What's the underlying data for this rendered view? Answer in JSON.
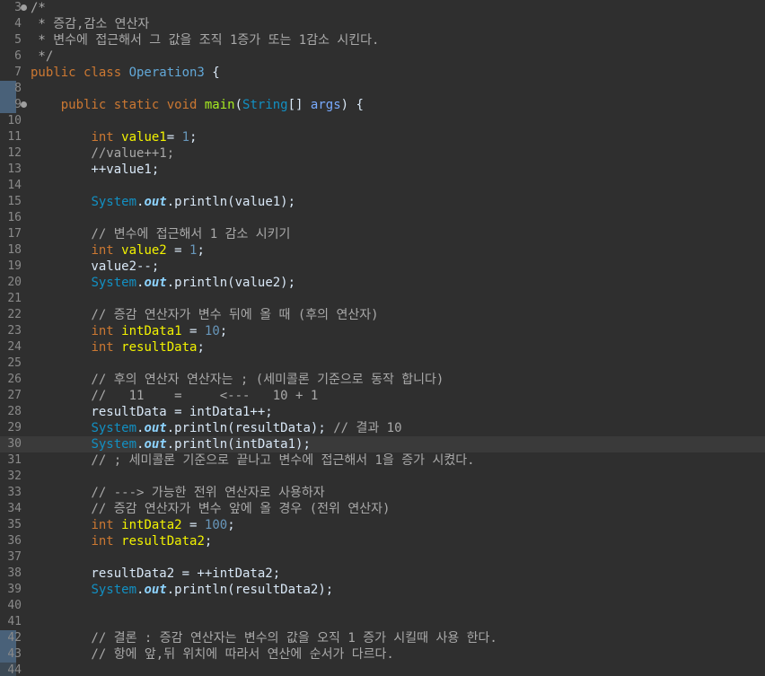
{
  "editor": {
    "lines": [
      {
        "num": "3",
        "fold": true,
        "mark": false,
        "current": false,
        "tokens": [
          {
            "t": "/*",
            "c": "comment"
          }
        ]
      },
      {
        "num": "4",
        "fold": false,
        "mark": false,
        "current": false,
        "tokens": [
          {
            "t": " * 증감,감소 연산자",
            "c": "comment"
          }
        ]
      },
      {
        "num": "5",
        "fold": false,
        "mark": false,
        "current": false,
        "tokens": [
          {
            "t": " * 변수에 접근해서 그 값을 조직 1증가 또는 1감소 시킨다.",
            "c": "comment"
          }
        ]
      },
      {
        "num": "6",
        "fold": false,
        "mark": false,
        "current": false,
        "tokens": [
          {
            "t": " */",
            "c": "comment"
          }
        ]
      },
      {
        "num": "7",
        "fold": false,
        "mark": false,
        "current": false,
        "tokens": [
          {
            "t": "public class ",
            "c": "keyword"
          },
          {
            "t": "Operation3",
            "c": "class"
          },
          {
            "t": " {",
            "c": "text"
          }
        ]
      },
      {
        "num": "8",
        "fold": false,
        "mark": true,
        "current": false,
        "tokens": []
      },
      {
        "num": "9",
        "fold": true,
        "mark": true,
        "current": false,
        "tokens": [
          {
            "t": "    ",
            "c": "text"
          },
          {
            "t": "public static void ",
            "c": "keyword"
          },
          {
            "t": "main",
            "c": "method"
          },
          {
            "t": "(",
            "c": "text"
          },
          {
            "t": "String",
            "c": "type"
          },
          {
            "t": "[] ",
            "c": "text"
          },
          {
            "t": "args",
            "c": "param"
          },
          {
            "t": ") {",
            "c": "text"
          }
        ]
      },
      {
        "num": "10",
        "fold": false,
        "mark": false,
        "current": false,
        "tokens": []
      },
      {
        "num": "11",
        "fold": false,
        "mark": false,
        "current": false,
        "tokens": [
          {
            "t": "        ",
            "c": "text"
          },
          {
            "t": "int ",
            "c": "keyword"
          },
          {
            "t": "value1",
            "c": "local"
          },
          {
            "t": "= ",
            "c": "text"
          },
          {
            "t": "1",
            "c": "number"
          },
          {
            "t": ";",
            "c": "text"
          }
        ]
      },
      {
        "num": "12",
        "fold": false,
        "mark": false,
        "current": false,
        "tokens": [
          {
            "t": "        //value++1;",
            "c": "comment"
          }
        ]
      },
      {
        "num": "13",
        "fold": false,
        "mark": false,
        "current": false,
        "tokens": [
          {
            "t": "        ++value1;",
            "c": "text"
          }
        ]
      },
      {
        "num": "14",
        "fold": false,
        "mark": false,
        "current": false,
        "tokens": []
      },
      {
        "num": "15",
        "fold": false,
        "mark": false,
        "current": false,
        "tokens": [
          {
            "t": "        ",
            "c": "text"
          },
          {
            "t": "System",
            "c": "type"
          },
          {
            "t": ".",
            "c": "text"
          },
          {
            "t": "out",
            "c": "field"
          },
          {
            "t": ".println(value1);",
            "c": "text"
          }
        ]
      },
      {
        "num": "16",
        "fold": false,
        "mark": false,
        "current": false,
        "tokens": []
      },
      {
        "num": "17",
        "fold": false,
        "mark": false,
        "current": false,
        "tokens": [
          {
            "t": "        // 변수에 접근해서 1 감소 시키기",
            "c": "comment"
          }
        ]
      },
      {
        "num": "18",
        "fold": false,
        "mark": false,
        "current": false,
        "tokens": [
          {
            "t": "        ",
            "c": "text"
          },
          {
            "t": "int ",
            "c": "keyword"
          },
          {
            "t": "value2",
            "c": "local"
          },
          {
            "t": " = ",
            "c": "text"
          },
          {
            "t": "1",
            "c": "number"
          },
          {
            "t": ";",
            "c": "text"
          }
        ]
      },
      {
        "num": "19",
        "fold": false,
        "mark": false,
        "current": false,
        "tokens": [
          {
            "t": "        value2--;",
            "c": "text"
          }
        ]
      },
      {
        "num": "20",
        "fold": false,
        "mark": false,
        "current": false,
        "tokens": [
          {
            "t": "        ",
            "c": "text"
          },
          {
            "t": "System",
            "c": "type"
          },
          {
            "t": ".",
            "c": "text"
          },
          {
            "t": "out",
            "c": "field"
          },
          {
            "t": ".println(value2);",
            "c": "text"
          }
        ]
      },
      {
        "num": "21",
        "fold": false,
        "mark": false,
        "current": false,
        "tokens": []
      },
      {
        "num": "22",
        "fold": false,
        "mark": false,
        "current": false,
        "tokens": [
          {
            "t": "        // 증감 연산자가 변수 뒤에 올 때 (후의 연산자)",
            "c": "comment"
          }
        ]
      },
      {
        "num": "23",
        "fold": false,
        "mark": false,
        "current": false,
        "tokens": [
          {
            "t": "        ",
            "c": "text"
          },
          {
            "t": "int ",
            "c": "keyword"
          },
          {
            "t": "intData1",
            "c": "local"
          },
          {
            "t": " = ",
            "c": "text"
          },
          {
            "t": "10",
            "c": "number"
          },
          {
            "t": ";",
            "c": "text"
          }
        ]
      },
      {
        "num": "24",
        "fold": false,
        "mark": false,
        "current": false,
        "tokens": [
          {
            "t": "        ",
            "c": "text"
          },
          {
            "t": "int ",
            "c": "keyword"
          },
          {
            "t": "resultData",
            "c": "local"
          },
          {
            "t": ";",
            "c": "text"
          }
        ]
      },
      {
        "num": "25",
        "fold": false,
        "mark": false,
        "current": false,
        "tokens": []
      },
      {
        "num": "26",
        "fold": false,
        "mark": false,
        "current": false,
        "tokens": [
          {
            "t": "        // 후의 연산자 연산자는 ; (세미콜론 기준으로 동작 합니다)",
            "c": "comment"
          }
        ]
      },
      {
        "num": "27",
        "fold": false,
        "mark": false,
        "current": false,
        "tokens": [
          {
            "t": "        //   11    =     <---   10 + 1",
            "c": "comment"
          }
        ]
      },
      {
        "num": "28",
        "fold": false,
        "mark": false,
        "current": false,
        "tokens": [
          {
            "t": "        resultData = intData1++;",
            "c": "text"
          }
        ]
      },
      {
        "num": "29",
        "fold": false,
        "mark": false,
        "current": false,
        "tokens": [
          {
            "t": "        ",
            "c": "text"
          },
          {
            "t": "System",
            "c": "type"
          },
          {
            "t": ".",
            "c": "text"
          },
          {
            "t": "out",
            "c": "field"
          },
          {
            "t": ".println(resultData); ",
            "c": "text"
          },
          {
            "t": "// 결과 10",
            "c": "comment"
          }
        ]
      },
      {
        "num": "30",
        "fold": false,
        "mark": false,
        "current": true,
        "tokens": [
          {
            "t": "        ",
            "c": "text"
          },
          {
            "t": "System",
            "c": "type"
          },
          {
            "t": ".",
            "c": "text"
          },
          {
            "t": "out",
            "c": "field"
          },
          {
            "t": ".println(intData1);",
            "c": "text"
          }
        ]
      },
      {
        "num": "31",
        "fold": false,
        "mark": false,
        "current": false,
        "tokens": [
          {
            "t": "        // ; 세미콜론 기준으로 끝나고 변수에 접근해서 1을 증가 시켰다.",
            "c": "comment"
          }
        ]
      },
      {
        "num": "32",
        "fold": false,
        "mark": false,
        "current": false,
        "tokens": []
      },
      {
        "num": "33",
        "fold": false,
        "mark": false,
        "current": false,
        "tokens": [
          {
            "t": "        // ---> 가능한 전위 연산자로 사용하자",
            "c": "comment"
          }
        ]
      },
      {
        "num": "34",
        "fold": false,
        "mark": false,
        "current": false,
        "tokens": [
          {
            "t": "        // 증감 연산자가 변수 앞에 올 경우 (전위 연산자)",
            "c": "comment"
          }
        ]
      },
      {
        "num": "35",
        "fold": false,
        "mark": false,
        "current": false,
        "tokens": [
          {
            "t": "        ",
            "c": "text"
          },
          {
            "t": "int ",
            "c": "keyword"
          },
          {
            "t": "intData2",
            "c": "local"
          },
          {
            "t": " = ",
            "c": "text"
          },
          {
            "t": "100",
            "c": "number"
          },
          {
            "t": ";",
            "c": "text"
          }
        ]
      },
      {
        "num": "36",
        "fold": false,
        "mark": false,
        "current": false,
        "tokens": [
          {
            "t": "        ",
            "c": "text"
          },
          {
            "t": "int ",
            "c": "keyword"
          },
          {
            "t": "resultData2",
            "c": "local"
          },
          {
            "t": ";",
            "c": "text"
          }
        ]
      },
      {
        "num": "37",
        "fold": false,
        "mark": false,
        "current": false,
        "tokens": []
      },
      {
        "num": "38",
        "fold": false,
        "mark": false,
        "current": false,
        "tokens": [
          {
            "t": "        resultData2 = ++intData2;",
            "c": "text"
          }
        ]
      },
      {
        "num": "39",
        "fold": false,
        "mark": false,
        "current": false,
        "tokens": [
          {
            "t": "        ",
            "c": "text"
          },
          {
            "t": "System",
            "c": "type"
          },
          {
            "t": ".",
            "c": "text"
          },
          {
            "t": "out",
            "c": "field"
          },
          {
            "t": ".println(resultData2);",
            "c": "text"
          }
        ]
      },
      {
        "num": "40",
        "fold": false,
        "mark": false,
        "current": false,
        "tokens": []
      },
      {
        "num": "41",
        "fold": false,
        "mark": false,
        "current": false,
        "tokens": []
      },
      {
        "num": "42",
        "fold": false,
        "mark": true,
        "current": false,
        "tokens": [
          {
            "t": "        // 결론 : 증감 연산자는 변수의 값을 오직 1 증가 시킬때 사용 한다.",
            "c": "comment"
          }
        ]
      },
      {
        "num": "43",
        "fold": false,
        "mark": true,
        "current": false,
        "tokens": [
          {
            "t": "        // 항에 앞,뒤 위치에 따라서 연산에 순서가 다르다.",
            "c": "comment"
          }
        ]
      },
      {
        "num": "44",
        "fold": false,
        "mark": true,
        "current": false,
        "tokens": []
      }
    ]
  }
}
